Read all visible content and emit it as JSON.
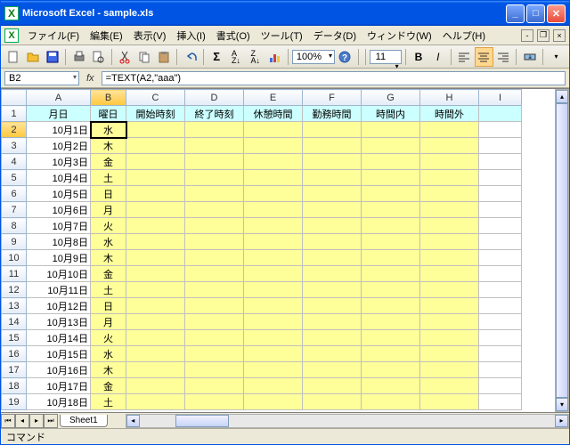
{
  "window": {
    "title": "Microsoft Excel - sample.xls"
  },
  "menus": {
    "file": "ファイル(F)",
    "edit": "編集(E)",
    "view": "表示(V)",
    "insert": "挿入(I)",
    "format": "書式(O)",
    "tools": "ツール(T)",
    "data": "データ(D)",
    "window": "ウィンドウ(W)",
    "help": "ヘルプ(H)"
  },
  "toolbar": {
    "zoom": "100%",
    "font_size": "11"
  },
  "formula_bar": {
    "name_box": "B2",
    "fx": "fx",
    "formula": "=TEXT(A2,\"aaa\")"
  },
  "columns": [
    "A",
    "B",
    "C",
    "D",
    "E",
    "F",
    "G",
    "H",
    "I"
  ],
  "header_row": {
    "A": "月日",
    "B": "曜日",
    "C": "開始時刻",
    "D": "終了時刻",
    "E": "休憩時間",
    "F": "勤務時間",
    "G": "時間内",
    "H": "時間外"
  },
  "rows": [
    {
      "n": 1
    },
    {
      "n": 2,
      "A": "10月1日",
      "B": "水"
    },
    {
      "n": 3,
      "A": "10月2日",
      "B": "木"
    },
    {
      "n": 4,
      "A": "10月3日",
      "B": "金"
    },
    {
      "n": 5,
      "A": "10月4日",
      "B": "土"
    },
    {
      "n": 6,
      "A": "10月5日",
      "B": "日"
    },
    {
      "n": 7,
      "A": "10月6日",
      "B": "月"
    },
    {
      "n": 8,
      "A": "10月7日",
      "B": "火"
    },
    {
      "n": 9,
      "A": "10月8日",
      "B": "水"
    },
    {
      "n": 10,
      "A": "10月9日",
      "B": "木"
    },
    {
      "n": 11,
      "A": "10月10日",
      "B": "金"
    },
    {
      "n": 12,
      "A": "10月11日",
      "B": "土"
    },
    {
      "n": 13,
      "A": "10月12日",
      "B": "日"
    },
    {
      "n": 14,
      "A": "10月13日",
      "B": "月"
    },
    {
      "n": 15,
      "A": "10月14日",
      "B": "火"
    },
    {
      "n": 16,
      "A": "10月15日",
      "B": "水"
    },
    {
      "n": 17,
      "A": "10月16日",
      "B": "木"
    },
    {
      "n": 18,
      "A": "10月17日",
      "B": "金"
    },
    {
      "n": 19,
      "A": "10月18日",
      "B": "土"
    }
  ],
  "active_cell": {
    "row": 2,
    "col": "B"
  },
  "sheet_tab": "Sheet1",
  "status": "コマンド"
}
